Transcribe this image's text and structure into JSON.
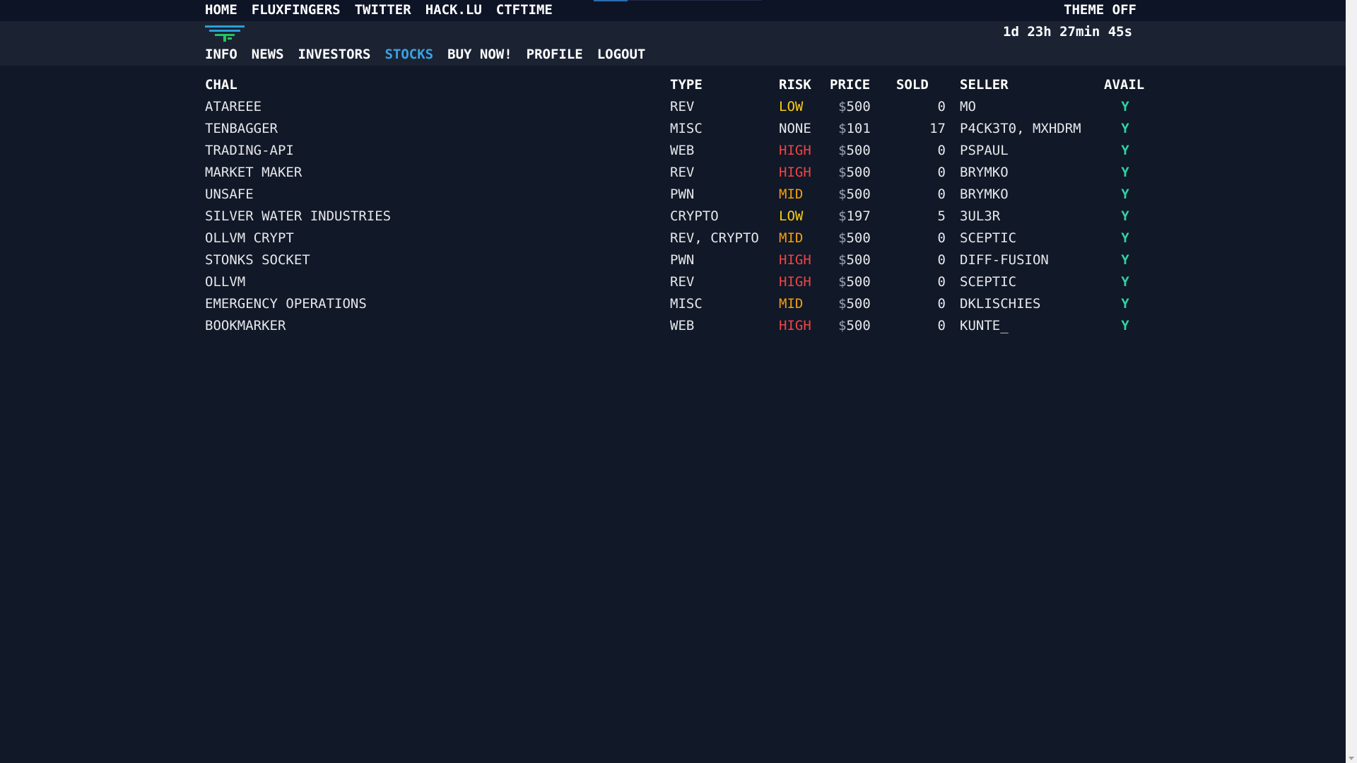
{
  "topnav": {
    "items": [
      "HOME",
      "FLUXFINGERS",
      "TWITTER",
      "HACK.LU",
      "CTFTIME"
    ],
    "theme": "THEME OFF"
  },
  "header": {
    "timer": "1d 23h 27min 45s",
    "logo": "fluxfingers-logo"
  },
  "mainnav": {
    "items": [
      "INFO",
      "NEWS",
      "INVESTORS",
      "STOCKS",
      "BUY NOW!",
      "PROFILE",
      "LOGOUT"
    ],
    "active": "STOCKS"
  },
  "table": {
    "headers": [
      "CHAL",
      "TYPE",
      "RISK",
      "PRICE",
      "SOLD",
      "SELLER",
      "AVAIL"
    ],
    "rows": [
      {
        "chal": "ATAREEE",
        "type": "REV",
        "risk": "LOW",
        "price": "500",
        "sold": "0",
        "seller": "MO",
        "avail": "Y"
      },
      {
        "chal": "TENBAGGER",
        "type": "MISC",
        "risk": "NONE",
        "price": "101",
        "sold": "17",
        "seller": "P4CK3T0, MXHDRM",
        "avail": "Y"
      },
      {
        "chal": "TRADING-API",
        "type": "WEB",
        "risk": "HIGH",
        "price": "500",
        "sold": "0",
        "seller": "PSPAUL",
        "avail": "Y"
      },
      {
        "chal": "MARKET MAKER",
        "type": "REV",
        "risk": "HIGH",
        "price": "500",
        "sold": "0",
        "seller": "BRYMKO",
        "avail": "Y"
      },
      {
        "chal": "UNSAFE",
        "type": "PWN",
        "risk": "MID",
        "price": "500",
        "sold": "0",
        "seller": "BRYMKO",
        "avail": "Y"
      },
      {
        "chal": "SILVER WATER INDUSTRIES",
        "type": "CRYPTO",
        "risk": "LOW",
        "price": "197",
        "sold": "5",
        "seller": "3UL3R",
        "avail": "Y"
      },
      {
        "chal": "OLLVM CRYPT",
        "type": "REV, CRYPTO",
        "risk": "MID",
        "price": "500",
        "sold": "0",
        "seller": "SCEPTIC",
        "avail": "Y"
      },
      {
        "chal": "STONKS SOCKET",
        "type": "PWN",
        "risk": "HIGH",
        "price": "500",
        "sold": "0",
        "seller": "DIFF-FUSION",
        "avail": "Y"
      },
      {
        "chal": "OLLVM",
        "type": "REV",
        "risk": "HIGH",
        "price": "500",
        "sold": "0",
        "seller": "SCEPTIC",
        "avail": "Y"
      },
      {
        "chal": "EMERGENCY OPERATIONS",
        "type": "MISC",
        "risk": "MID",
        "price": "500",
        "sold": "0",
        "seller": "DKLISCHIES",
        "avail": "Y"
      },
      {
        "chal": "BOOKMARKER",
        "type": "WEB",
        "risk": "HIGH",
        "price": "500",
        "sold": "0",
        "seller": "KUNTE_",
        "avail": "Y"
      }
    ]
  },
  "colors": {
    "background": "#111827",
    "active_nav": "#3aa3e3",
    "risk_low": "#facc15",
    "risk_mid": "#f59e0b",
    "risk_high": "#ef4444",
    "avail": "#2dd4a4"
  }
}
